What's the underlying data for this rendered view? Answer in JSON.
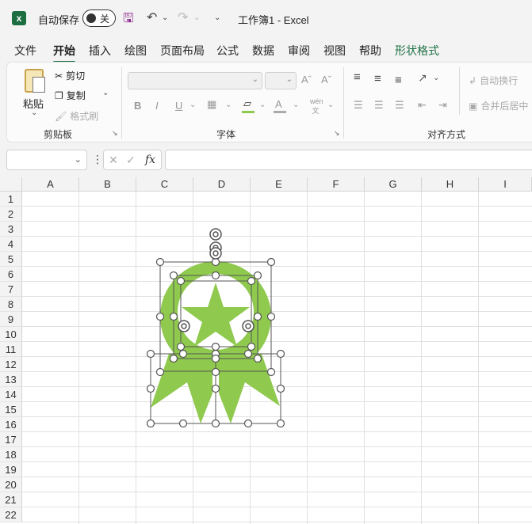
{
  "titlebar": {
    "autosave_label": "自动保存",
    "autosave_state": "关",
    "title": "工作簿1  -  Excel"
  },
  "tabs": [
    "文件",
    "开始",
    "插入",
    "绘图",
    "页面布局",
    "公式",
    "数据",
    "审阅",
    "视图",
    "帮助",
    "形状格式"
  ],
  "ribbon": {
    "clipboard": {
      "paste": "粘贴",
      "cut": "剪切",
      "copy": "复制",
      "format_painter": "格式刷",
      "label": "剪贴板"
    },
    "font": {
      "bold": "B",
      "italic": "I",
      "underline": "U",
      "label": "字体"
    },
    "alignment": {
      "wrap_text": "自动换行",
      "merge_center": "合并后居中",
      "label": "对齐方式"
    }
  },
  "formula_bar": {
    "name_box": "",
    "fx": "fx",
    "content": ""
  },
  "sheet": {
    "columns": [
      "A",
      "B",
      "C",
      "D",
      "E",
      "F",
      "G",
      "H",
      "I"
    ],
    "rows": [
      "1",
      "2",
      "3",
      "4",
      "5",
      "6",
      "7",
      "8",
      "9",
      "10",
      "11",
      "12",
      "13",
      "14",
      "15",
      "16",
      "17",
      "18",
      "19",
      "20",
      "21",
      "22"
    ]
  },
  "colors": {
    "accent": "#1d6f42",
    "shape_fill": "#8fc94e"
  },
  "icons": [
    "excel-logo-icon",
    "save-icon",
    "undo-icon",
    "redo-icon",
    "paste-icon",
    "scissors-icon",
    "copy-icon",
    "format-painter-icon",
    "rotate-handle-icon"
  ]
}
